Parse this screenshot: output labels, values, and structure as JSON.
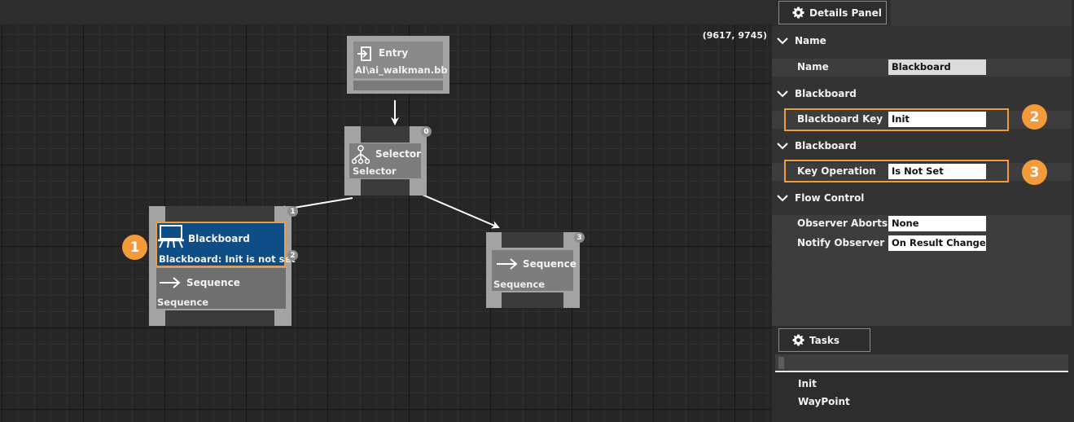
{
  "canvas": {
    "coords": "(9617, 9745)",
    "nodes": {
      "entry": {
        "title": "Entry",
        "sub": "AI\\ai_walkman.bb",
        "icon": "entry-icon"
      },
      "selector": {
        "title": "Selector",
        "sub": "Selector",
        "badge": "0",
        "icon": "tree-icon"
      },
      "blackboard_node": {
        "title": "Blackboard",
        "sub": "Blackboard: Init is not set",
        "badge": "1",
        "badge2": "2",
        "icon": "blackboard-icon"
      },
      "sequence_left": {
        "title": "Sequence",
        "sub": "Sequence",
        "icon": "arrow-right-icon"
      },
      "sequence_right": {
        "title": "Sequence",
        "sub": "Sequence",
        "badge": "3",
        "icon": "arrow-right-icon"
      }
    },
    "callouts": [
      "1",
      "2",
      "3"
    ]
  },
  "details_panel": {
    "tab_label": "Details Panel",
    "sections": [
      {
        "header": "Name",
        "rows": [
          {
            "label": "Name",
            "value": "Blackboard"
          }
        ]
      },
      {
        "header": "Blackboard",
        "rows": [
          {
            "label": "Blackboard Key",
            "value": "Init"
          }
        ]
      },
      {
        "header": "Blackboard",
        "rows": [
          {
            "label": "Key Operation",
            "value": "Is Not Set"
          }
        ]
      },
      {
        "header": "Flow Control",
        "rows": [
          {
            "label": "Observer Aborts",
            "value": "None"
          },
          {
            "label": "Notify Observer",
            "value": "On Result Change"
          }
        ]
      }
    ]
  },
  "tasks_panel": {
    "tab_label": "Tasks",
    "items": [
      "Init",
      "WayPoint"
    ]
  },
  "colors": {
    "accent": "#f39a3a",
    "selected_node": "#0f4d87",
    "node_frame": "#a3a3a3",
    "node_inner": "#7d7d7d",
    "canvas_bg": "#262626",
    "panel_bg": "#2d2d2d",
    "row_bg": "#3d3d3d"
  }
}
